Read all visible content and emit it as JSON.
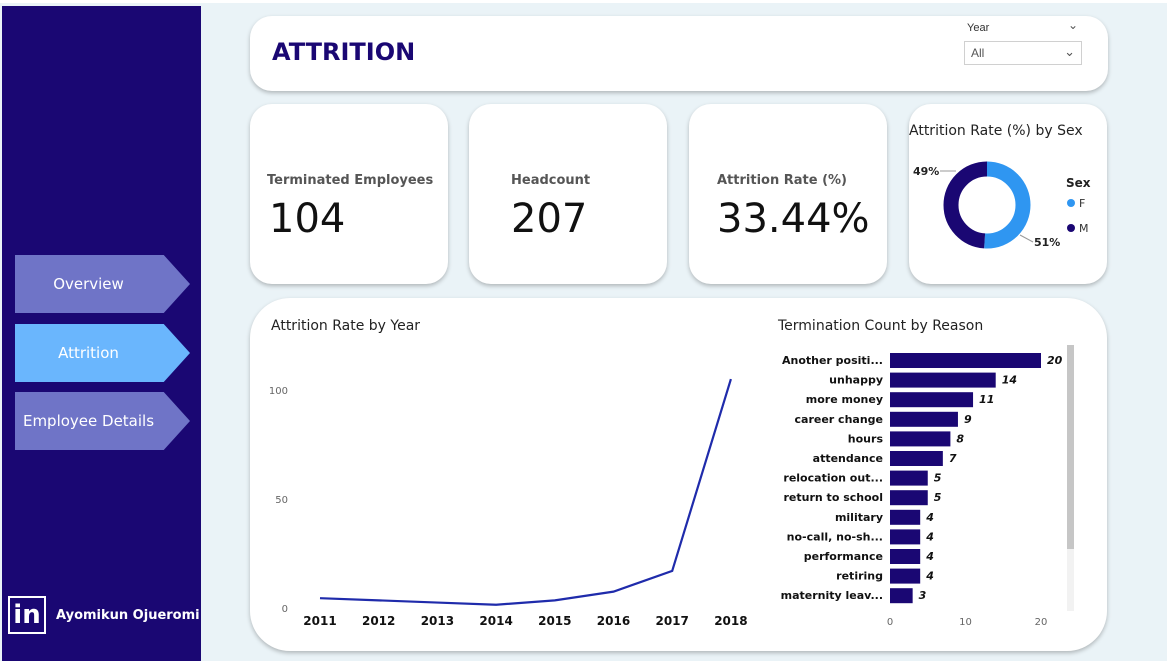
{
  "sidebar": {
    "nav": [
      {
        "label": "Overview",
        "active": false
      },
      {
        "label": "Attrition",
        "active": true
      },
      {
        "label": "Employee Details",
        "active": false
      }
    ],
    "brand_icon": "in",
    "brand_name": "Ayomikun Ojueromi"
  },
  "header": {
    "title": "ATTRITION",
    "slicer_label": "Year",
    "slicer_value": "All"
  },
  "kpis": [
    {
      "label": "Terminated Employees",
      "value": "104"
    },
    {
      "label": "Headcount",
      "value": "207"
    },
    {
      "label": "Attrition Rate (%)",
      "value": "33.44%"
    }
  ],
  "colors": {
    "navy": "#1a0773",
    "blue": "#2f96f1",
    "nav_inactive": "#6f74c7",
    "nav_active": "#6ab6fd"
  },
  "chart_data": [
    {
      "type": "pie",
      "title": "Attrition Rate (%) by Sex",
      "legend_title": "Sex",
      "labels": [
        "F",
        "M"
      ],
      "values": [
        51,
        49
      ],
      "value_labels": [
        "51%",
        "49%"
      ],
      "colors": [
        "#2f96f1",
        "#1a0773"
      ],
      "legend_position": "right"
    },
    {
      "type": "line",
      "title": "Attrition Rate by Year",
      "x": [
        "2011",
        "2012",
        "2013",
        "2014",
        "2015",
        "2016",
        "2017",
        "2018"
      ],
      "y": [
        4.5,
        3.5,
        2.5,
        1.5,
        3.5,
        7.5,
        17,
        105
      ],
      "yticks": [
        "0",
        "50",
        "100"
      ],
      "ylim": [
        0,
        105
      ]
    },
    {
      "type": "bar",
      "title": "Termination Count by Reason",
      "categories": [
        "Another positi...",
        "unhappy",
        "more money",
        "career change",
        "hours",
        "attendance",
        "relocation out...",
        "return to school",
        "military",
        "no-call, no-sh...",
        "performance",
        "retiring",
        "maternity leav..."
      ],
      "values": [
        20,
        14,
        11,
        9,
        8,
        7,
        5,
        5,
        4,
        4,
        4,
        4,
        3
      ],
      "xticks": [
        "0",
        "10",
        "20"
      ],
      "xlim": [
        0,
        20
      ]
    }
  ]
}
